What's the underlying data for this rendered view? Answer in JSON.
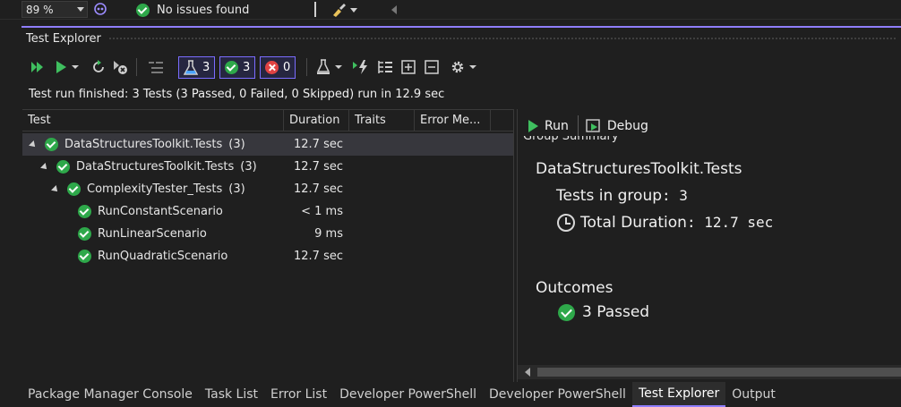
{
  "statusbar": {
    "zoom": "89 %",
    "issues": "No issues found"
  },
  "panel": {
    "title": "Test Explorer",
    "summary": "Test run finished: 3 Tests (3 Passed, 0 Failed, 0 Skipped) run in 12.9 sec"
  },
  "toolbar": {
    "total_count": "3",
    "passed_count": "3",
    "failed_count": "0"
  },
  "columns": [
    "Test",
    "Duration",
    "Traits",
    "Error Me..."
  ],
  "tree": [
    {
      "name": "DataStructuresToolkit.Tests",
      "count": "(3)",
      "duration": "12.7 sec"
    },
    {
      "name": "DataStructuresToolkit.Tests",
      "count": "(3)",
      "duration": "12.7 sec"
    },
    {
      "name": "ComplexityTester_Tests",
      "count": "(3)",
      "duration": "12.7 sec"
    },
    {
      "name": "RunConstantScenario",
      "count": "",
      "duration": "< 1 ms"
    },
    {
      "name": "RunLinearScenario",
      "count": "",
      "duration": "9 ms"
    },
    {
      "name": "RunQuadraticScenario",
      "count": "",
      "duration": "12.7 sec"
    }
  ],
  "detail": {
    "run_label": "Run",
    "debug_label": "Debug",
    "clipped_heading": "Group Summary",
    "group_name": "DataStructuresToolkit.Tests",
    "tests_in_group_label": "Tests in group",
    "tests_in_group_value": "3",
    "total_duration_label": "Total Duration",
    "total_duration_value": "12.7 sec",
    "outcomes_label": "Outcomes",
    "passed_label": "3 Passed"
  },
  "bottom_tabs": [
    "Package Manager Console",
    "Task List",
    "Error List",
    "Developer PowerShell",
    "Developer PowerShell",
    "Test Explorer",
    "Output"
  ],
  "colors": {
    "accent": "#8f7dff",
    "passed": "#2ea84a",
    "failed": "#e04343",
    "run_green": "#3fbf5f"
  }
}
